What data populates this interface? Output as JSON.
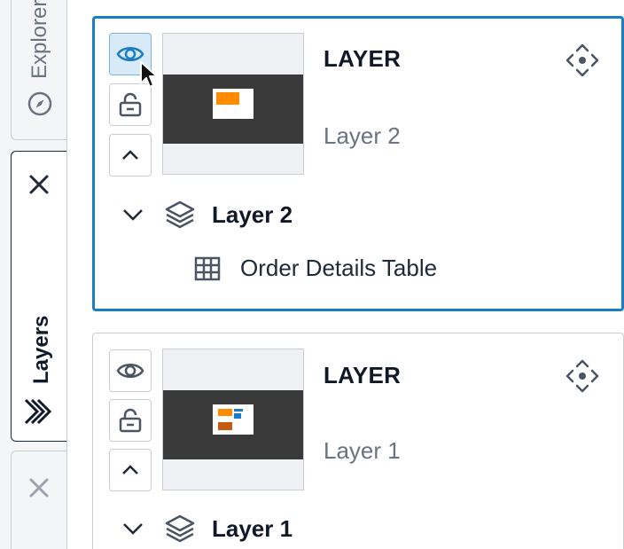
{
  "tabs": {
    "explorer_label": "Explorer",
    "layers_label": "Layers"
  },
  "layers": [
    {
      "kind": "LAYER",
      "name": "Layer 2",
      "tree_title": "Layer 2",
      "children": [
        "Order Details Table"
      ]
    },
    {
      "kind": "LAYER",
      "name": "Layer 1",
      "tree_title": "Layer 1",
      "children": []
    }
  ],
  "colors": {
    "accent": "#1a7dc5",
    "thumb_orange": "#ff8c00",
    "thumb_dark": "#3a3a3a"
  },
  "icons": {
    "visibility": "eye-icon",
    "lock": "unlock-icon",
    "move_up": "chevron-up-icon",
    "expand": "chevron-down-icon",
    "layer": "layers-icon",
    "table": "table-grid-icon",
    "move": "move-arrows-icon",
    "close": "close-icon",
    "explorer": "compass-icon"
  }
}
